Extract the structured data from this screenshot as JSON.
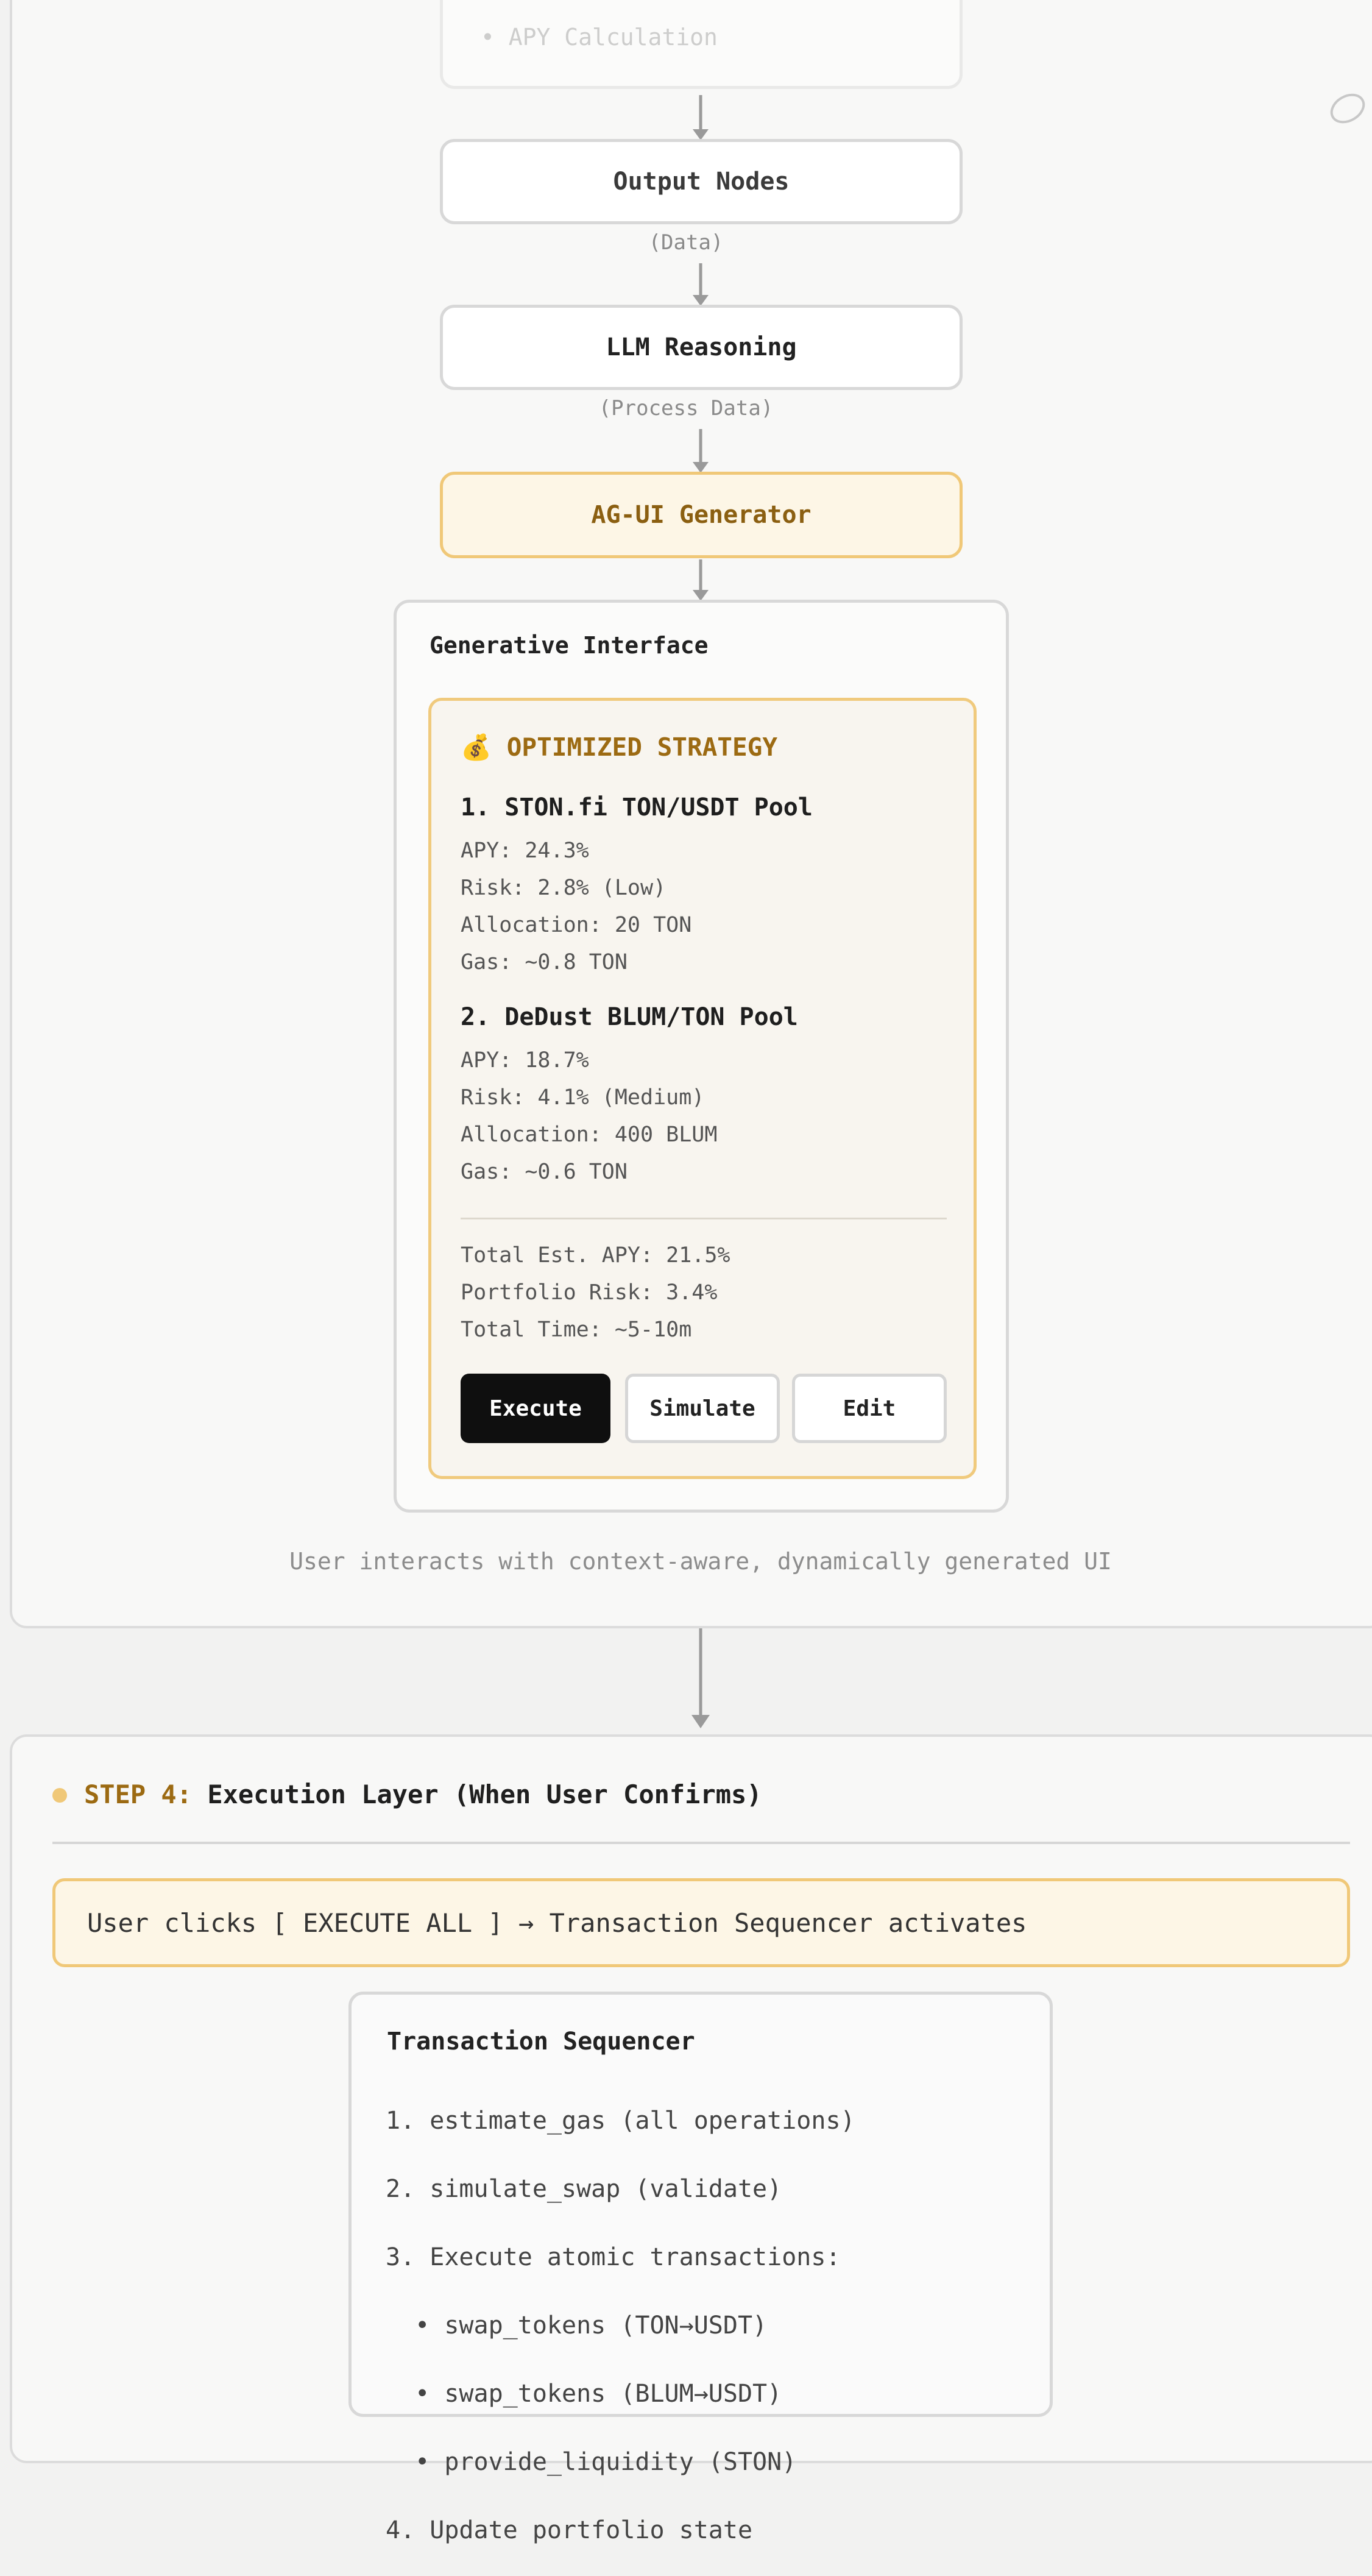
{
  "flow": {
    "faded_item": "• APY Calculation",
    "output_nodes": "Output Nodes",
    "edge_data": "(Data)",
    "llm_reasoning": "LLM Reasoning",
    "edge_process": "(Process Data)",
    "agui_generator": "AG-UI Generator"
  },
  "generative_interface": {
    "title": "Generative Interface",
    "strategy_title": "💰 OPTIMIZED STRATEGY",
    "pools": [
      {
        "title": "1. STON.fi TON/USDT Pool",
        "metrics": [
          "APY: 24.3%",
          "Risk: 2.8% (Low)",
          "Allocation: 20 TON",
          "Gas: ~0.8 TON"
        ]
      },
      {
        "title": "2. DeDust BLUM/TON Pool",
        "metrics": [
          "APY: 18.7%",
          "Risk: 4.1% (Medium)",
          "Allocation: 400 BLUM",
          "Gas: ~0.6 TON"
        ]
      }
    ],
    "summary": [
      "Total Est. APY: 21.5%",
      "Portfolio Risk: 3.4%",
      "Total Time: ~5-10m"
    ],
    "buttons": {
      "execute": "Execute",
      "simulate": "Simulate",
      "edit": "Edit"
    }
  },
  "caption": "User interacts with context-aware, dynamically generated UI",
  "step4": {
    "label": "STEP 4:",
    "title": "Execution Layer (When User Confirms)",
    "note": "User clicks [ EXECUTE ALL ] → Transaction Sequencer activates",
    "sequencer": {
      "title": "Transaction Sequencer",
      "lines": [
        "1. estimate_gas (all operations)",
        "2. simulate_swap (validate)",
        "3. Execute atomic transactions:",
        "  • swap_tokens (TON→USDT)",
        "  • swap_tokens (BLUM→USDT)",
        "  • provide_liquidity (STON)",
        "4. Update portfolio state"
      ]
    }
  },
  "colors": {
    "accent_gold": "#f0c878",
    "gold_text": "#9c6a12",
    "button_dark": "#0f0f0f",
    "panel_border": "#dcdcdc"
  }
}
